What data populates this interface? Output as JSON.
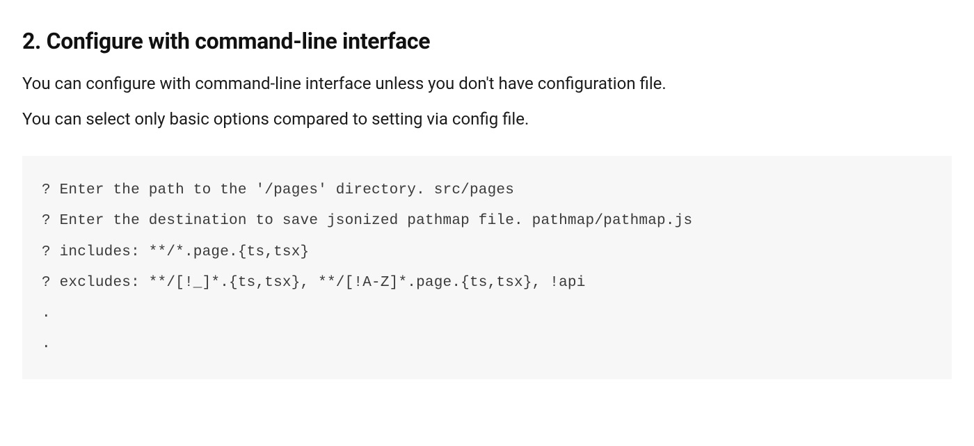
{
  "heading": "2. Configure with command-line interface",
  "paragraphs": [
    "You can configure with command-line interface unless you don't have configuration file.",
    "You can select only basic options compared to setting via config file."
  ],
  "code_lines": [
    "? Enter the path to the '/pages' directory. src/pages",
    "? Enter the destination to save jsonized pathmap file. pathmap/pathmap.js",
    "? includes: **/*.page.{ts,tsx}",
    "? excludes: **/[!_]*.{ts,tsx}, **/[!A-Z]*.page.{ts,tsx}, !api",
    ".",
    "."
  ]
}
